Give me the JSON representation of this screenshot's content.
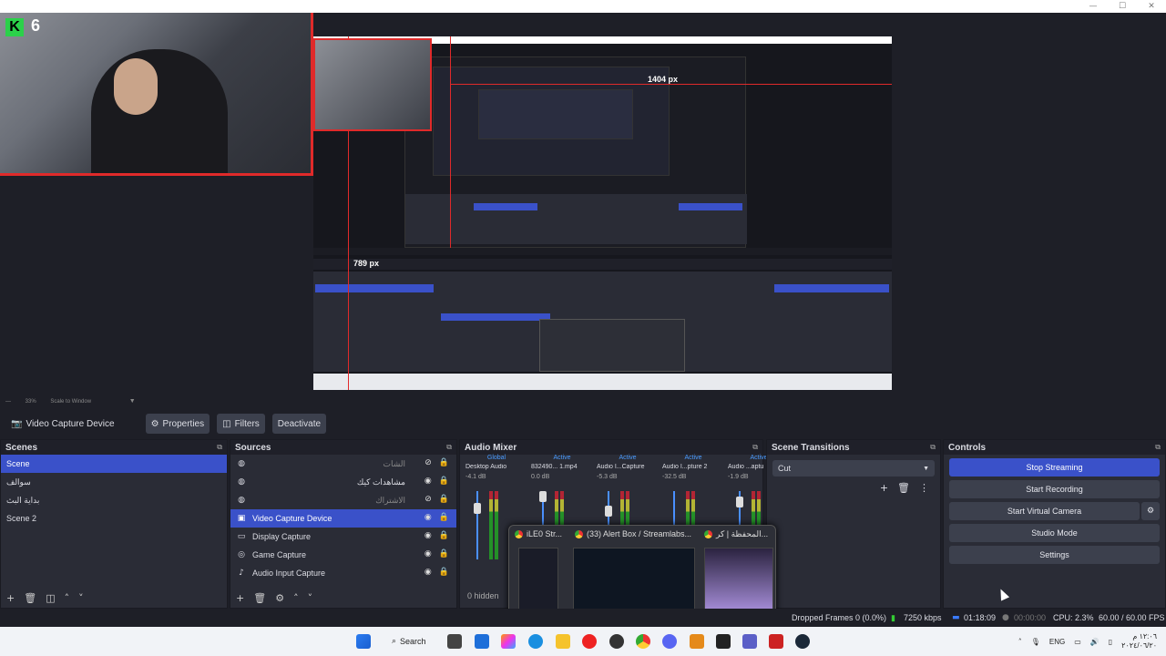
{
  "webcam": {
    "badge_letter": "K",
    "badge_count": "6"
  },
  "preview": {
    "measure_horizontal": "1404 px",
    "measure_vertical": "789 px"
  },
  "zoom": {
    "label": "Scale to Window",
    "percent": "33%"
  },
  "toolbar": {
    "source_name": "Video Capture Device",
    "properties_label": "Properties",
    "filters_label": "Filters",
    "deactivate_label": "Deactivate"
  },
  "scenes": {
    "title": "Scenes",
    "items": [
      {
        "label": "Scene",
        "selected": true
      },
      {
        "label": "سوالف"
      },
      {
        "label": "بداية البث"
      },
      {
        "label": "Scene 2"
      }
    ]
  },
  "sources": {
    "title": "Sources",
    "items": [
      {
        "label": "الشات",
        "icon": "globe-icon"
      },
      {
        "label": "مشاهدات كيك",
        "icon": "globe-icon"
      },
      {
        "label": "الاشتراك",
        "icon": "globe-icon"
      },
      {
        "label": "Video Capture Device",
        "icon": "camera-icon",
        "selected": true
      },
      {
        "label": "Display Capture",
        "icon": "monitor-icon"
      },
      {
        "label": "Game Capture",
        "icon": "gamepad-icon"
      },
      {
        "label": "Audio Input Capture",
        "icon": "microphone-icon"
      }
    ]
  },
  "mixer": {
    "title": "Audio Mixer",
    "hidden_label": "0 hidden",
    "channels": [
      {
        "status": "Global",
        "name": "Desktop Audio",
        "db": "-4.1 dB",
        "level": 0.8
      },
      {
        "status": "Active",
        "name": "832490... 1.mp4",
        "db": "0.0 dB",
        "level": 1.0
      },
      {
        "status": "Active",
        "name": "Audio I...Capture",
        "db": "-5.3 dB",
        "level": 0.75
      },
      {
        "status": "Active",
        "name": "Audio I...pture 2",
        "db": "-32.5 dB",
        "level": 0.3
      },
      {
        "status": "Active",
        "name": "Audio ...aptu",
        "db": "-1.9 dB",
        "level": 0.9
      }
    ]
  },
  "transitions": {
    "title": "Scene Transitions",
    "selected": "Cut"
  },
  "controls": {
    "title": "Controls",
    "buttons": [
      {
        "label": "Stop Streaming",
        "active": true
      },
      {
        "label": "Start Recording"
      },
      {
        "label": "Start Virtual Camera"
      },
      {
        "label": "Studio Mode"
      },
      {
        "label": "Settings"
      }
    ]
  },
  "popup": {
    "tabs": [
      "iLE0 Str...",
      "(33) Alert Box / Streamlabs...",
      "المحفظة | كر..."
    ]
  },
  "status": {
    "dropped": "Dropped Frames 0 (0.0%)",
    "bitrate": "7250 kbps",
    "stream_time": "01:18:09",
    "rec_time": "00:00:00",
    "cpu": "CPU: 2.3%",
    "fps": "60.00 / 60.00 FPS"
  },
  "taskbar": {
    "search": "Search",
    "lang": "ENG",
    "clock": "١٢:٠٦ م",
    "date": "٢٠٢٤/٠٦/٢٠"
  },
  "colors": {
    "accent": "#3a51c9",
    "record": "#e02a2a"
  }
}
